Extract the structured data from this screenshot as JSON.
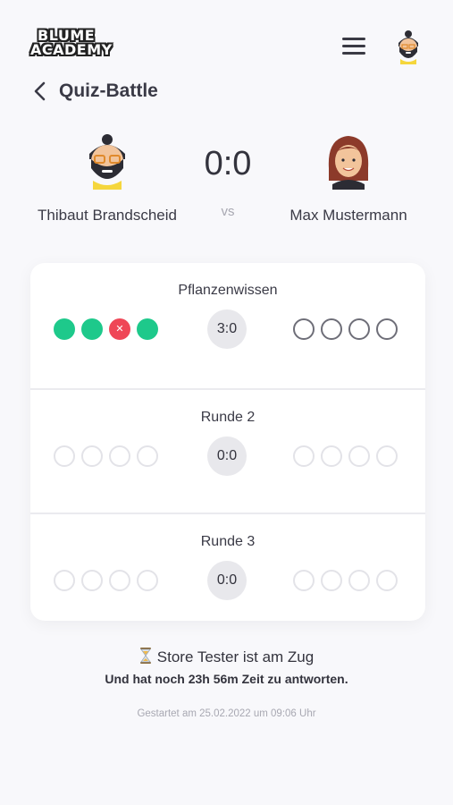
{
  "header": {
    "logo_line1": "BLUME",
    "logo_line2": "ACADEMY",
    "menu_icon": "hamburger-icon",
    "avatar_icon": "user-avatar-icon"
  },
  "page": {
    "title": "Quiz-Battle",
    "back_icon": "chevron-left-icon"
  },
  "battle": {
    "player_left": "Thibaut Brandscheid",
    "player_right": "Max Mustermann",
    "score": "0:0",
    "vs_label": "vs"
  },
  "rounds": [
    {
      "title": "Pflanzenwissen",
      "score": "3:0",
      "left": [
        "correct",
        "correct",
        "wrong",
        "correct"
      ],
      "right": [
        "open",
        "open",
        "open",
        "open"
      ]
    },
    {
      "title": "Runde 2",
      "score": "0:0",
      "left": [
        "empty",
        "empty",
        "empty",
        "empty"
      ],
      "right": [
        "empty",
        "empty",
        "empty",
        "empty"
      ]
    },
    {
      "title": "Runde 3",
      "score": "0:0",
      "left": [
        "empty",
        "empty",
        "empty",
        "empty"
      ],
      "right": [
        "empty",
        "empty",
        "empty",
        "empty"
      ]
    }
  ],
  "status": {
    "turn_text": "Store Tester ist am Zug",
    "time_left": "Und hat noch 23h 56m Zeit zu antworten.",
    "started": "Gestartet am 25.02.2022 um 09:06 Uhr",
    "hourglass_icon": "hourglass-icon"
  },
  "colors": {
    "correct": "#1ec98b",
    "wrong": "#ef4757",
    "open": "#6e6e78",
    "empty": "#e3e3e8"
  }
}
